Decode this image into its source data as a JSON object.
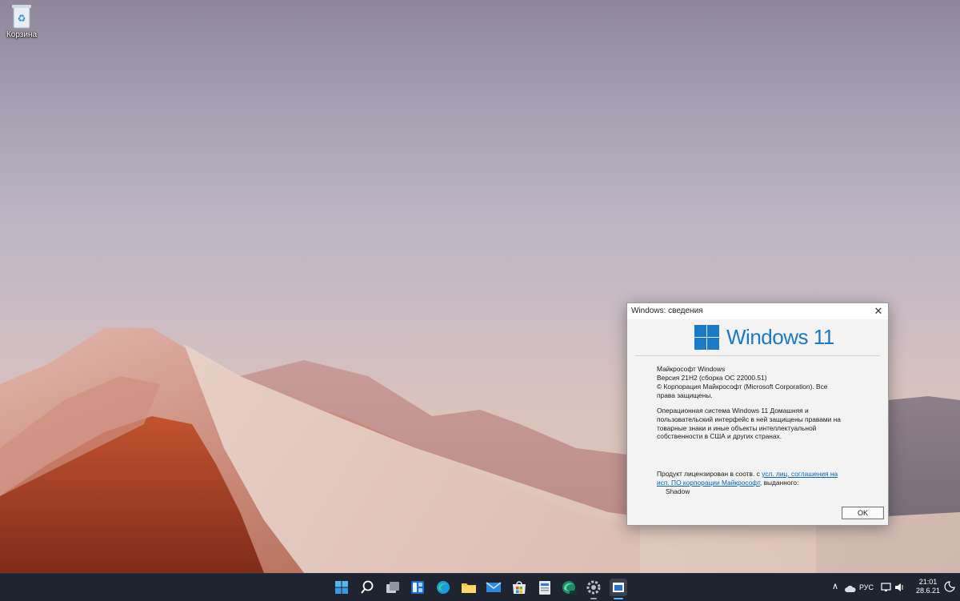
{
  "desktop": {
    "icons": [
      {
        "label": "Корзина",
        "icon": "recycle-bin-icon"
      }
    ]
  },
  "about_dialog": {
    "title": "Windows: сведения",
    "logo_text": "Windows 11",
    "product_name": "Майкрософт Windows",
    "version": "Версия 21H2 (сборка ОС 22000.51)",
    "copyright": "© Корпорация Майкрософт (Microsoft Corporation). Все права защищены.",
    "description": "Операционная система Windows 11 Домашняя и пользовательский интерфейс в ней защищены правами на товарные знаки и иные объекты интеллектуальной собственности в США и других странах.",
    "license_prefix": "Продукт лицензирован в соотв. с ",
    "license_link": "усл. лиц. соглашения на исп. ПО корпорации Майкрософт",
    "license_suffix": ", выданного:",
    "licensed_to": "Shadow",
    "ok_label": "OK",
    "brand_color": "#1b7ac7"
  },
  "taskbar": {
    "apps": [
      "start-icon",
      "search-icon",
      "task-view-icon",
      "widgets-icon",
      "edge-icon",
      "file-explorer-icon",
      "mail-icon",
      "store-icon",
      "news-icon",
      "edge-dev-icon",
      "settings-icon",
      "winver-icon"
    ],
    "tray": {
      "language": "РУС",
      "time": "21:01",
      "date": "28.6.21"
    }
  }
}
